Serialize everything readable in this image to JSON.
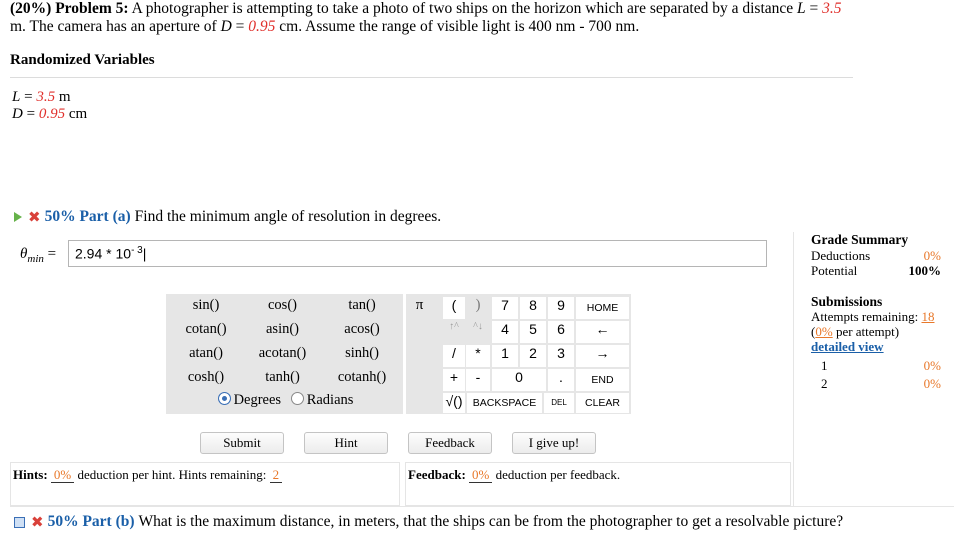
{
  "problem": {
    "prefix": "(20%) Problem 5:",
    "text1": "A photographer is attempting to take a photo of two ships on the horizon which are separated by a distance ",
    "L_sym": "L",
    "eq": " = ",
    "L_val": "3.5",
    "text2": " m. The camera has an aperture of ",
    "D_sym": "D",
    "D_val": "0.95",
    "text3": " cm. Assume the range of visible light is 400 nm - 700 nm."
  },
  "randomized": {
    "title": "Randomized Variables",
    "L_sym": "L",
    "L_val": "3.5",
    "L_unit": "m",
    "D_sym": "D",
    "D_val": "0.95",
    "D_unit": "cm"
  },
  "part_a": {
    "percent": "50% Part (a)",
    "question": "Find the minimum angle of resolution in degrees.",
    "theta_label": "θ",
    "theta_sub": "min",
    "equals": "=",
    "answer": "2.94 * 10",
    "answer_exp": "- 3"
  },
  "grade_summary": {
    "title": "Grade Summary",
    "deductions_label": "Deductions",
    "deductions_value": "0%",
    "potential_label": "Potential",
    "potential_value": "100%"
  },
  "submissions": {
    "title": "Submissions",
    "attempts_label": "Attempts remaining:",
    "attempts_value": "18",
    "per_attempt_pct": "0%",
    "per_attempt_text": " per attempt)",
    "detailed": "detailed view",
    "rows": [
      {
        "n": "1",
        "pct": "0%"
      },
      {
        "n": "2",
        "pct": "0%"
      }
    ]
  },
  "calculator": {
    "functions": [
      [
        "sin()",
        "cos()",
        "tan()"
      ],
      [
        "cotan()",
        "asin()",
        "acos()"
      ],
      [
        "atan()",
        "acotan()",
        "sinh()"
      ],
      [
        "cosh()",
        "tanh()",
        "cotanh()"
      ]
    ],
    "degrees": "Degrees",
    "radians": "Radians",
    "pi": "π",
    "lparen": "(",
    "rparen": ")",
    "up": "↑^",
    "down": "^↓",
    "div": "/",
    "mul": "*",
    "plus": "+",
    "minus": "-",
    "sqrt": "√()",
    "digits": [
      "7",
      "8",
      "9",
      "4",
      "5",
      "6",
      "1",
      "2",
      "3",
      "0",
      "."
    ],
    "home": "HOME",
    "left": "←",
    "right": "→",
    "end": "END",
    "backspace": "BACKSPACE",
    "del": "DEL",
    "clear": "CLEAR"
  },
  "buttons": {
    "submit": "Submit",
    "hint": "Hint",
    "feedback": "Feedback",
    "giveup": "I give up!"
  },
  "hints": {
    "label": "Hints:",
    "pct": "0%",
    "text": " deduction per hint. Hints remaining: ",
    "remaining": "2"
  },
  "feedback": {
    "label": "Feedback:",
    "pct": "0%",
    "text": " deduction per feedback."
  },
  "part_b": {
    "percent": "50% Part (b)",
    "question": "What is the maximum distance, in meters, that the ships can be from the photographer to get a resolvable picture?"
  },
  "colors": {
    "accent_blue": "#1a5fa8",
    "variable_red": "#e0302c",
    "orange": "#e8782a",
    "calc_gray": "#e6e6e6"
  }
}
